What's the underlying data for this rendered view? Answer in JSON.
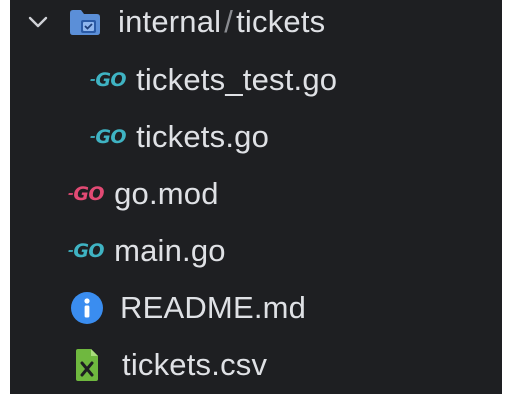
{
  "tree": {
    "folder": {
      "name": "internal",
      "separator": "/",
      "subname": "tickets",
      "expanded": true,
      "icon": "folder-icon"
    },
    "children": [
      {
        "label": "tickets_test.go",
        "icon": "go-test-icon",
        "icon_text": "GO"
      },
      {
        "label": "tickets.go",
        "icon": "go-icon",
        "icon_text": "GO"
      }
    ],
    "root_files": [
      {
        "label": "go.mod",
        "icon": "go-mod-icon",
        "icon_text": "GO"
      },
      {
        "label": "main.go",
        "icon": "go-icon",
        "icon_text": "GO"
      },
      {
        "label": "README.md",
        "icon": "info-icon"
      },
      {
        "label": "tickets.csv",
        "icon": "csv-file-icon"
      }
    ]
  },
  "colors": {
    "panel_bg": "#1e1f22",
    "text": "#dfe1e5",
    "go_cyan": "#3fb3c3",
    "go_mod_red": "#e24a74",
    "info_blue": "#3a8df0",
    "csv_green": "#6fb83f",
    "folder_blue": "#5b8fd8"
  }
}
